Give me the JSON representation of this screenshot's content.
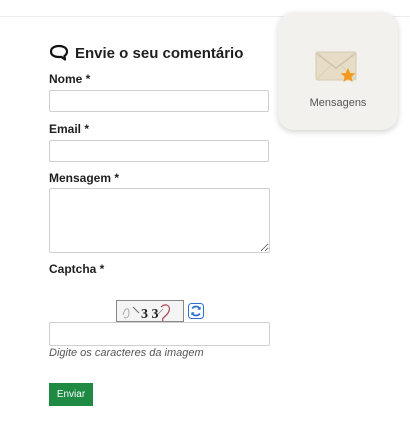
{
  "form": {
    "title": "Envie o seu comentário",
    "fields": {
      "name_label": "Nome *",
      "email_label": "Email *",
      "message_label": "Mensagem *",
      "captcha_label": "Captcha *",
      "name_value": "",
      "email_value": "",
      "message_value": "",
      "captcha_value": ""
    },
    "captcha_hint": "Digite os caracteres da imagem",
    "captcha_image_text": "3 3",
    "submit_label": "Enviar"
  },
  "widget": {
    "label": "Mensagens",
    "icon": "envelope-star-icon"
  },
  "colors": {
    "submit_bg": "#1e8a43",
    "widget_bg": "#f2f1ee",
    "star": "#f29a1f",
    "refresh": "#2a6fd6"
  },
  "icons": {
    "title": "speech-bubble-icon",
    "refresh": "refresh-icon"
  }
}
